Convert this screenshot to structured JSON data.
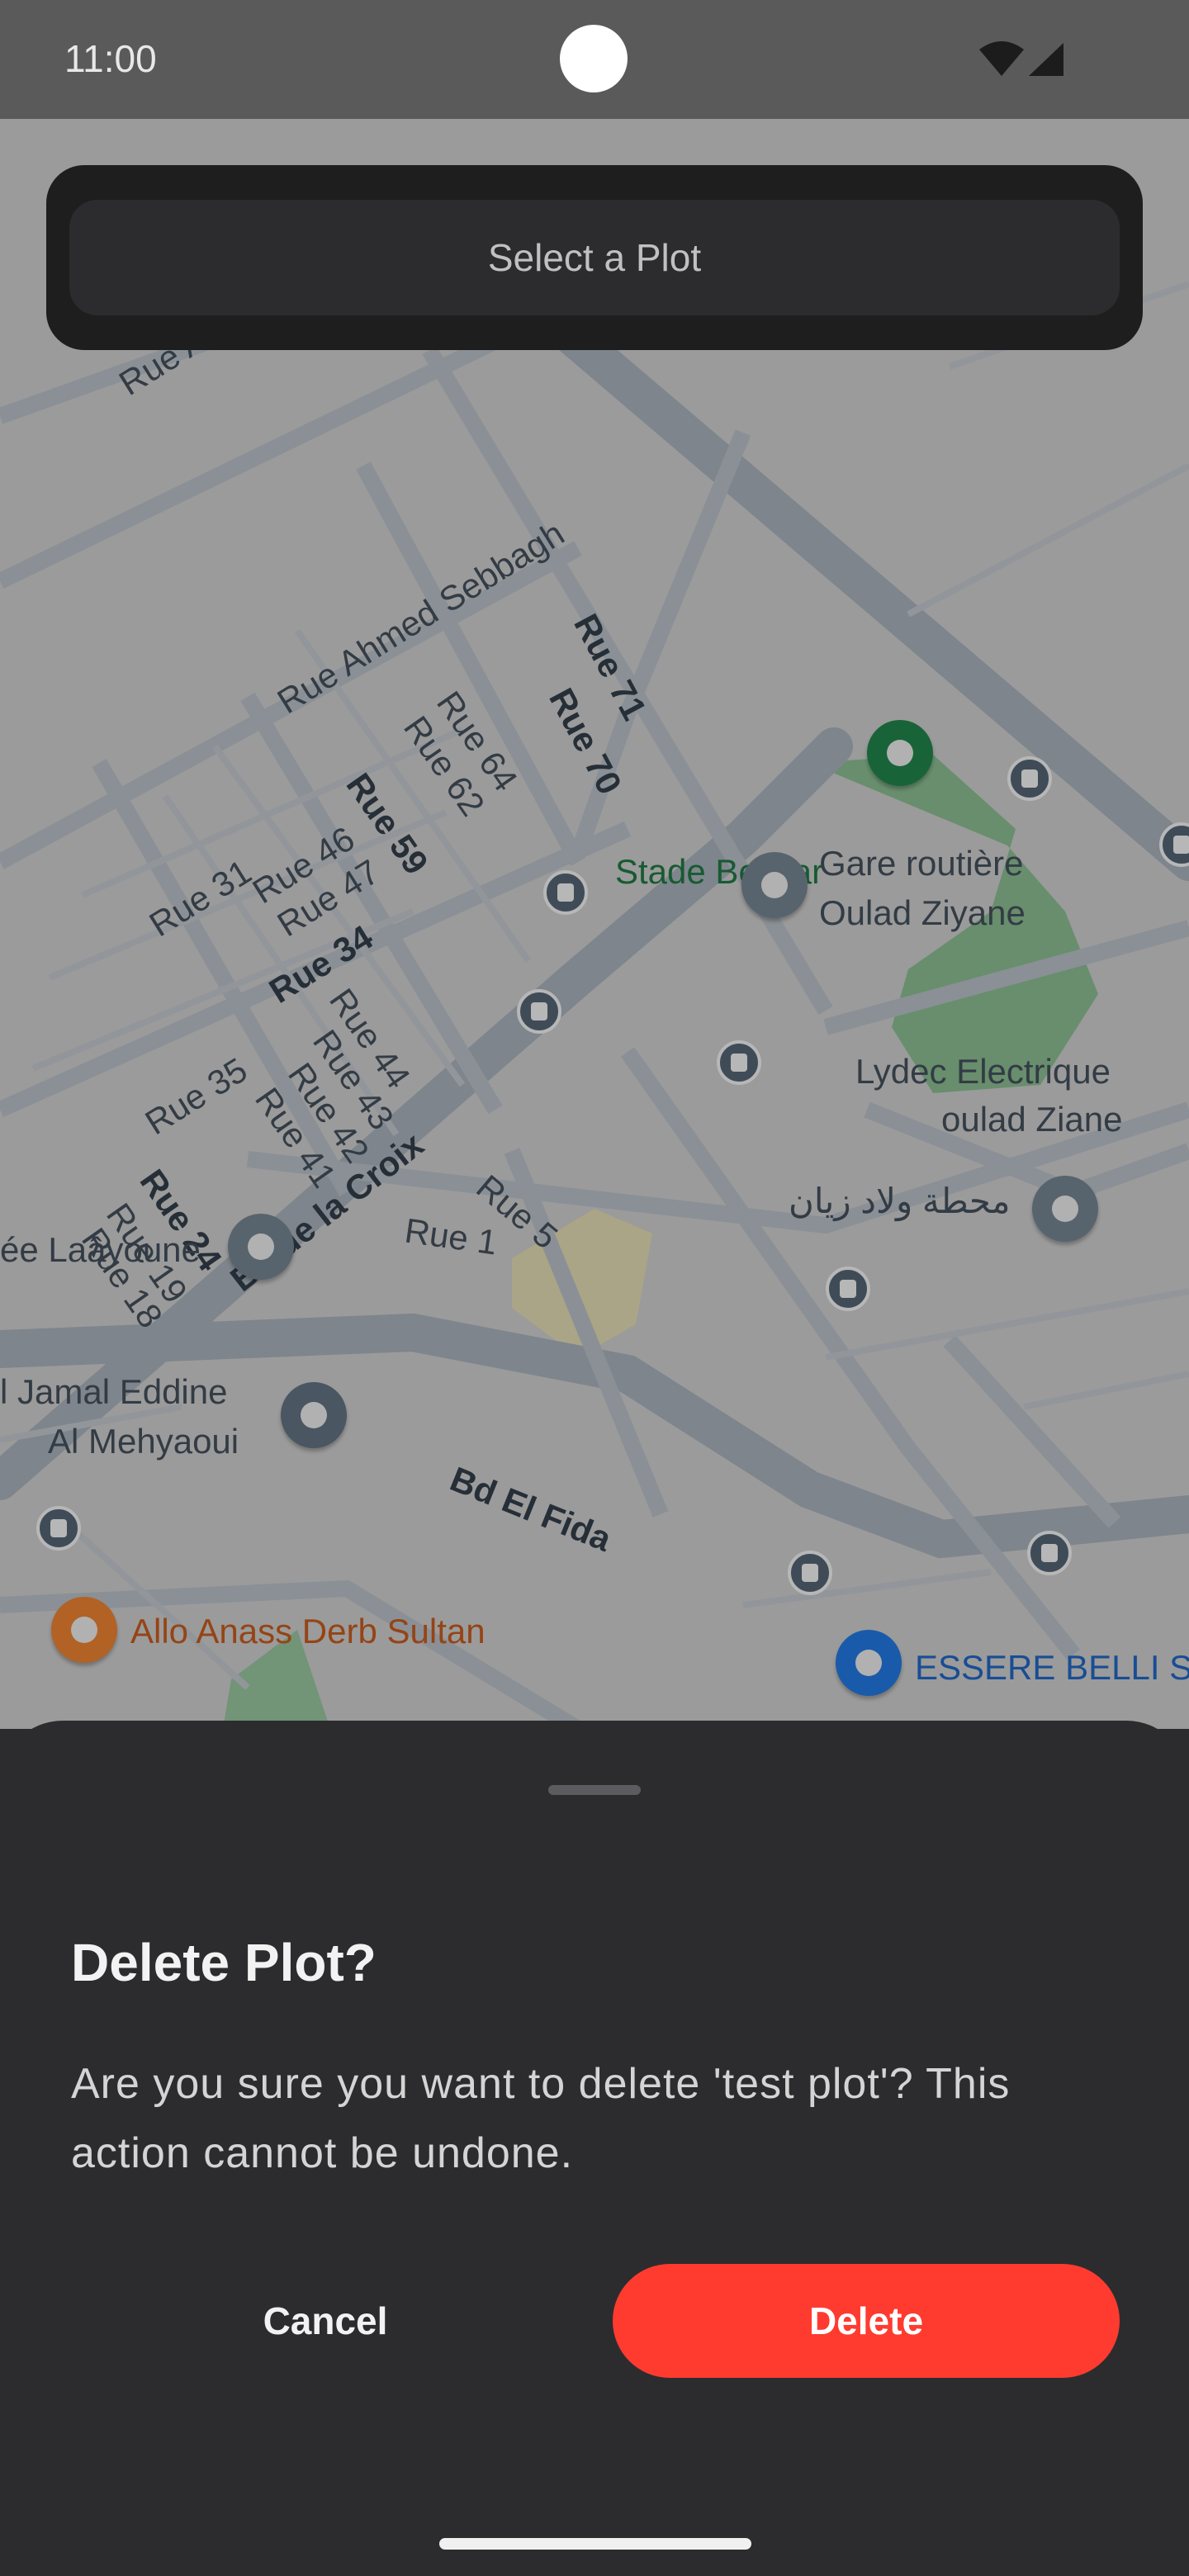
{
  "status_bar": {
    "time": "11:00"
  },
  "top_card": {
    "select_plot_label": "Select a Plot"
  },
  "map": {
    "labels": {
      "rue_ahmed_sebbagh": "Rue Ahmed Sebbagh",
      "rue_71": "Rue 71",
      "rue_70": "Rue 70",
      "rue_64": "Rue 64",
      "rue_62": "Rue 62",
      "rue_59": "Rue 59",
      "rue_46": "Rue 46",
      "rue_47": "Rue 47",
      "rue_31": "Rue 31",
      "rue_34": "Rue 34",
      "rue_44": "Rue 44",
      "rue_43": "Rue 43",
      "rue_42": "Rue 42",
      "rue_41": "Rue 41",
      "rue_35": "Rue 35",
      "rue_24": "Rue 24",
      "rue_19": "Rue 19",
      "rue_18": "Rue 18",
      "rue_5": "Rue 5",
      "rue_1": "Rue 1",
      "bd_de_la_croix": "Bd de la Croix",
      "bd_el_fida": "Bd El Fida",
      "rue_a_top": "Rue A",
      "stade_bekkar": "Stade Bekkar",
      "gare_routiere_1": "Gare routière",
      "gare_routiere_2": "Oulad Ziyane",
      "lydec_1": "Lydec Electrique",
      "lydec_2": "oulad Ziane",
      "arabic_station": "محطة ولاد زيان",
      "laayoune": "ée Laâyoune",
      "jamal_1": "l Jamal Eddine",
      "jamal_2": "Al Mehyaoui",
      "allo_anass": "Allo Anass Derb Sultan",
      "essere_belli": "ESSERE BELLI S"
    }
  },
  "dialog": {
    "title": "Delete Plot?",
    "message": "Are you sure you want to delete 'test plot'? This action cannot be undone.",
    "cancel_label": "Cancel",
    "delete_label": "Delete"
  },
  "colors": {
    "delete_accent": "#ff3b30",
    "sheet_background": "#2c2c2e"
  }
}
